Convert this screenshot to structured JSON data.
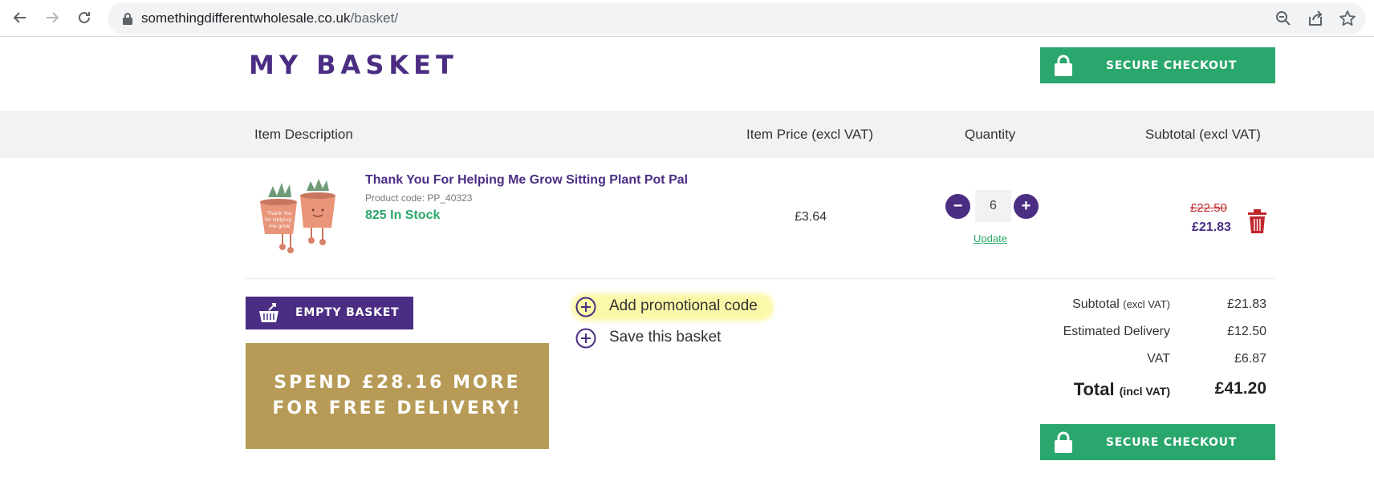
{
  "browser": {
    "url_domain": "somethingdifferentwholesale.co.uk",
    "url_path": "/basket/"
  },
  "page": {
    "title": "MY BASKET",
    "checkout_label": "SECURE CHECKOUT"
  },
  "table": {
    "headers": {
      "description": "Item Description",
      "price": "Item Price (excl VAT)",
      "quantity": "Quantity",
      "subtotal": "Subtotal (excl VAT)"
    }
  },
  "item": {
    "name": "Thank You For Helping Me Grow Sitting Plant Pot Pal",
    "code": "Product code: PP_40323",
    "stock": "825 In Stock",
    "unit_price": "£3.64",
    "quantity": "6",
    "update_label": "Update",
    "old_subtotal": "£22.50",
    "subtotal": "£21.83",
    "minus_label": "−",
    "plus_label": "+"
  },
  "actions": {
    "empty_basket": "EMPTY BASKET",
    "add_promo": "Add promotional code",
    "save_basket": "Save this basket"
  },
  "promo_banner": {
    "text": "SPEND £28.16 MORE\nFOR FREE DELIVERY!"
  },
  "summary": {
    "subtotal_label": "Subtotal",
    "subtotal_note": "(excl VAT)",
    "subtotal_value": "£21.83",
    "delivery_label": "Estimated Delivery",
    "delivery_value": "£12.50",
    "vat_label": "VAT",
    "vat_value": "£6.87",
    "total_label": "Total",
    "total_note": "(incl VAT)",
    "total_value": "£41.20"
  },
  "colors": {
    "brand_purple": "#4b2d83",
    "checkout_green": "#2aa76c",
    "banner_gold": "#b69a56",
    "strike_red": "#c0272d"
  }
}
